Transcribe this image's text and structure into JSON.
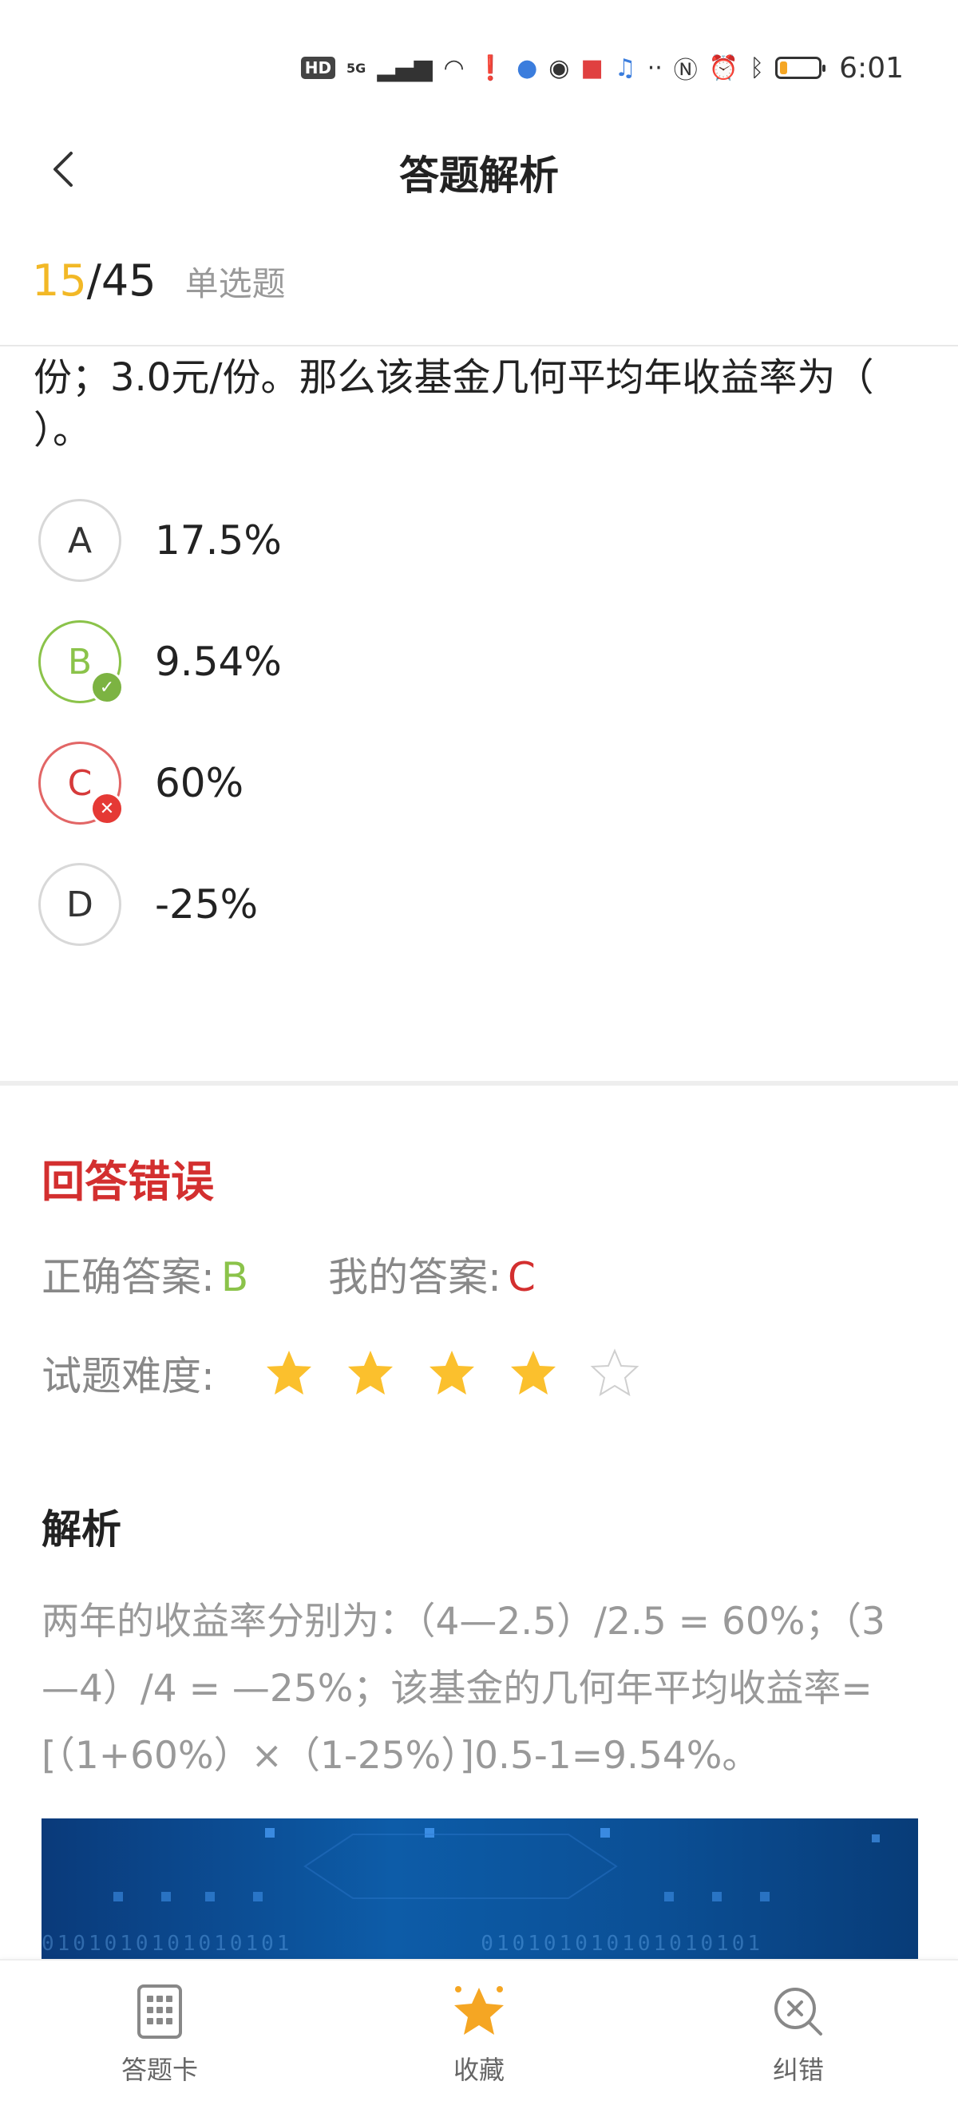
{
  "status_bar": {
    "time": "6:01",
    "network": "5G",
    "hd_badge": "HD",
    "battery_level": 0.2
  },
  "header": {
    "title": "答题解析"
  },
  "progress": {
    "current": "15",
    "separator": "/",
    "total": "45",
    "question_type": "单选题"
  },
  "question": {
    "text_visible": "份；3.0元/份。那么该基金几何平均年收益率为（ ）。"
  },
  "options": [
    {
      "letter": "A",
      "text": "17.5%",
      "state": "normal"
    },
    {
      "letter": "B",
      "text": "9.54%",
      "state": "correct"
    },
    {
      "letter": "C",
      "text": "60%",
      "state": "wrong"
    },
    {
      "letter": "D",
      "text": "-25%",
      "state": "normal"
    }
  ],
  "result": {
    "title": "回答错误",
    "correct_label": "正确答案:",
    "correct_value": "B",
    "mine_label": "我的答案:",
    "mine_value": "C",
    "difficulty_label": "试题难度:",
    "difficulty_stars": 4,
    "difficulty_max": 5
  },
  "analysis": {
    "title": "解析",
    "text": "两年的收益率分别为：（4—2.5）/2.5 = 60%；（3—4）/4 = —25%；该基金的几何年平均收益率=[（1+60%）×（1-25%）]0.5-1=9.54%。"
  },
  "bottom_nav": {
    "answer_card": "答题卡",
    "favorite": "收藏",
    "correction": "纠错"
  },
  "colors": {
    "accent_yellow": "#f2b826",
    "correct_green": "#8bc34a",
    "wrong_red": "#d32f2f",
    "star_gold": "#fbc02d"
  }
}
